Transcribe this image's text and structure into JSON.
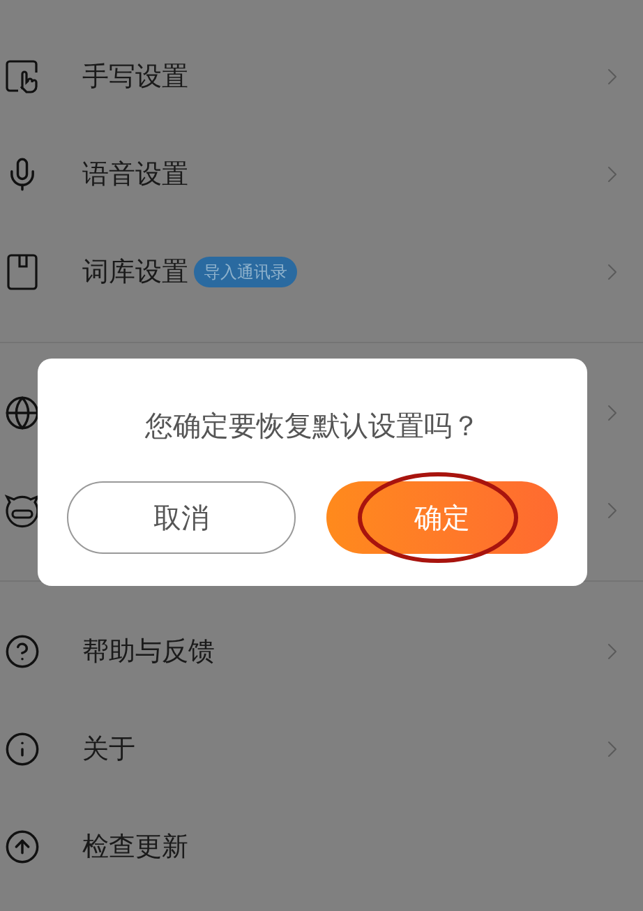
{
  "sections": [
    {
      "items": [
        {
          "label": "手写设置",
          "chevron": true
        },
        {
          "label": "语音设置",
          "chevron": true
        },
        {
          "label": "词库设置",
          "badge": "导入通讯录",
          "chevron": true
        }
      ]
    },
    {
      "items": [
        {
          "chevron": true
        },
        {
          "chevron": true
        }
      ]
    },
    {
      "items": [
        {
          "label": "帮助与反馈",
          "chevron": true
        },
        {
          "label": "关于",
          "chevron": true
        },
        {
          "label": "检查更新",
          "chevron": false
        }
      ]
    }
  ],
  "dialog": {
    "message": "您确定要恢复默认设置吗？",
    "cancel": "取消",
    "confirm": "确定",
    "confirm_highlighted": true
  }
}
